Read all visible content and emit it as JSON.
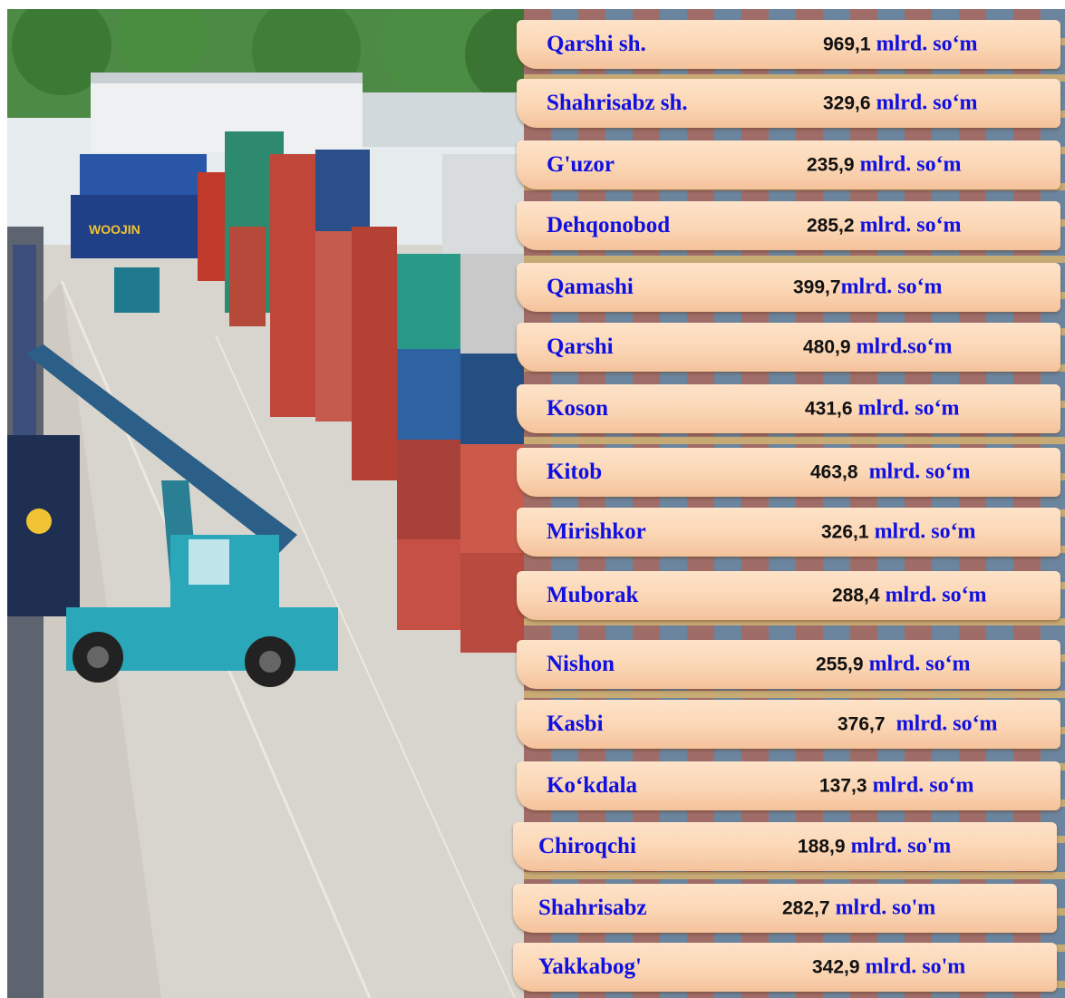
{
  "rows": [
    {
      "name": "Qarshi sh.",
      "value": "969,1",
      "unit": " mlrd. so‘m"
    },
    {
      "name": "Shahrisabz sh.",
      "value": "329,6",
      "unit": " mlrd. so‘m"
    },
    {
      "name": "G'uzor",
      "value": "235,9",
      "unit": " mlrd. so‘m"
    },
    {
      "name": "Dehqonobod",
      "value": "285,2",
      "unit": " mlrd. so‘m"
    },
    {
      "name": "Qamashi",
      "value": "399,7",
      "unit": "mlrd. so‘m"
    },
    {
      "name": "Qarshi",
      "value": "480,9",
      "unit": " mlrd.so‘m"
    },
    {
      "name": "Koson",
      "value": "431,6",
      "unit": " mlrd. so‘m"
    },
    {
      "name": "Kitob",
      "value": "463,8",
      "unit": "  mlrd. so‘m"
    },
    {
      "name": "Mirishkor",
      "value": "326,1",
      "unit": " mlrd. so‘m"
    },
    {
      "name": "Muborak",
      "value": "288,4",
      "unit": " mlrd. so‘m"
    },
    {
      "name": "Nishon",
      "value": "255,9",
      "unit": " mlrd. so‘m"
    },
    {
      "name": "Kasbi",
      "value": "376,7",
      "unit": "  mlrd. so‘m"
    },
    {
      "name": "Ko‘kdala",
      "value": "137,3",
      "unit": " mlrd. so‘m"
    },
    {
      "name": "Chiroqchi",
      "value": "188,9",
      "unit": " mlrd. so'm"
    },
    {
      "name": "Shahrisabz",
      "value": "282,7",
      "unit": " mlrd. so'm"
    },
    {
      "name": "Yakkabog'",
      "value": "342,9",
      "unit": " mlrd. so'm"
    }
  ],
  "photo": {
    "container_logo_text": "WOOJIN",
    "colors": {
      "ground": "#d9d6d0",
      "sky": "#e8eef2",
      "crane": "#2aa7b8",
      "trees": "#3f7d3a"
    }
  }
}
